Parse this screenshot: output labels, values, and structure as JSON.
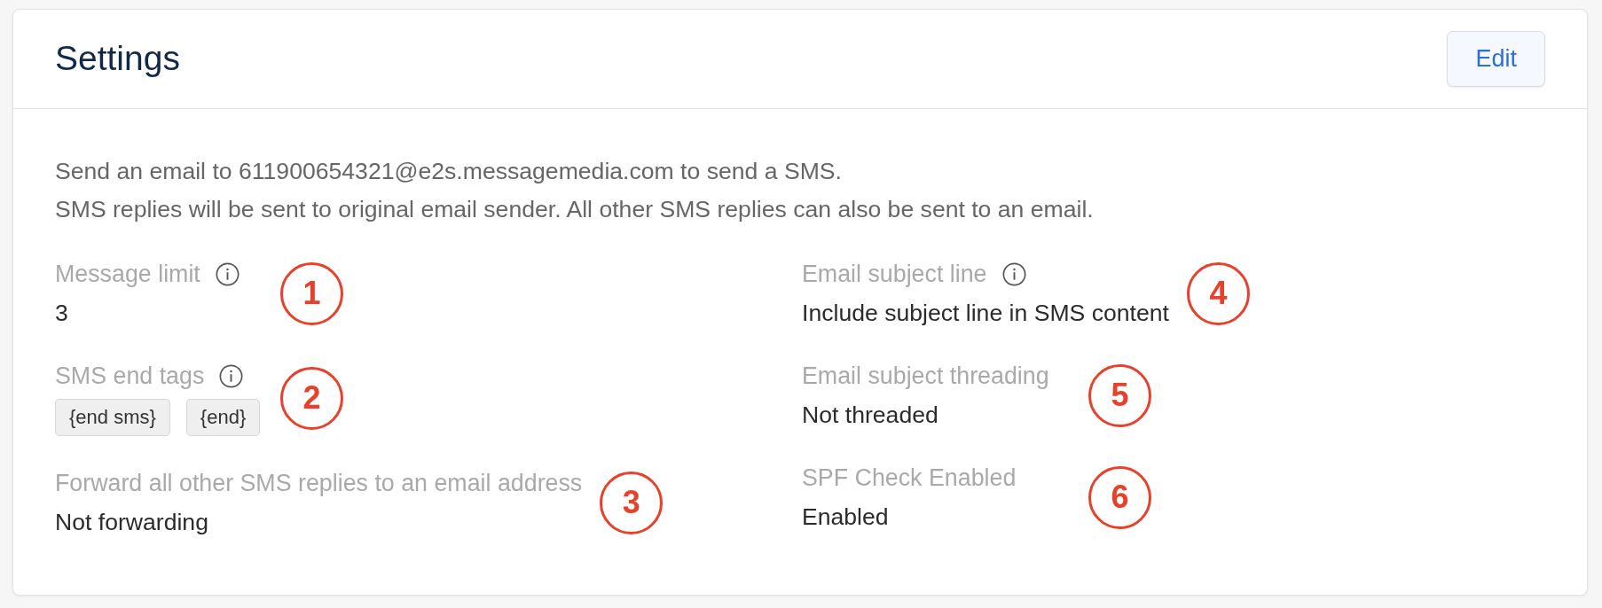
{
  "card": {
    "title": "Settings",
    "edit_button": "Edit"
  },
  "description": [
    "Send an email to 611900654321@e2s.messagemedia.com to send a SMS.",
    "SMS replies will be sent to original email sender. All other SMS replies can also be sent to an email."
  ],
  "columns": [
    {
      "settings": [
        {
          "label": "Message limit",
          "info": true,
          "kind": "text",
          "value": "3",
          "annotation": "1"
        },
        {
          "label": "SMS end tags",
          "info": true,
          "kind": "tags",
          "tags": [
            "{end sms}",
            "{end}"
          ],
          "annotation": "2"
        },
        {
          "label": "Forward all other SMS replies to an email address",
          "info": false,
          "kind": "text",
          "value": "Not forwarding",
          "annotation": "3"
        }
      ]
    },
    {
      "settings": [
        {
          "label": "Email subject line",
          "info": true,
          "kind": "text",
          "value": "Include subject line in SMS content",
          "annotation": "4"
        },
        {
          "label": "Email subject threading",
          "info": false,
          "kind": "text",
          "value": "Not threaded",
          "annotation": "5"
        },
        {
          "label": "SPF Check Enabled",
          "info": false,
          "kind": "text",
          "value": "Enabled",
          "annotation": "6"
        }
      ]
    }
  ]
}
